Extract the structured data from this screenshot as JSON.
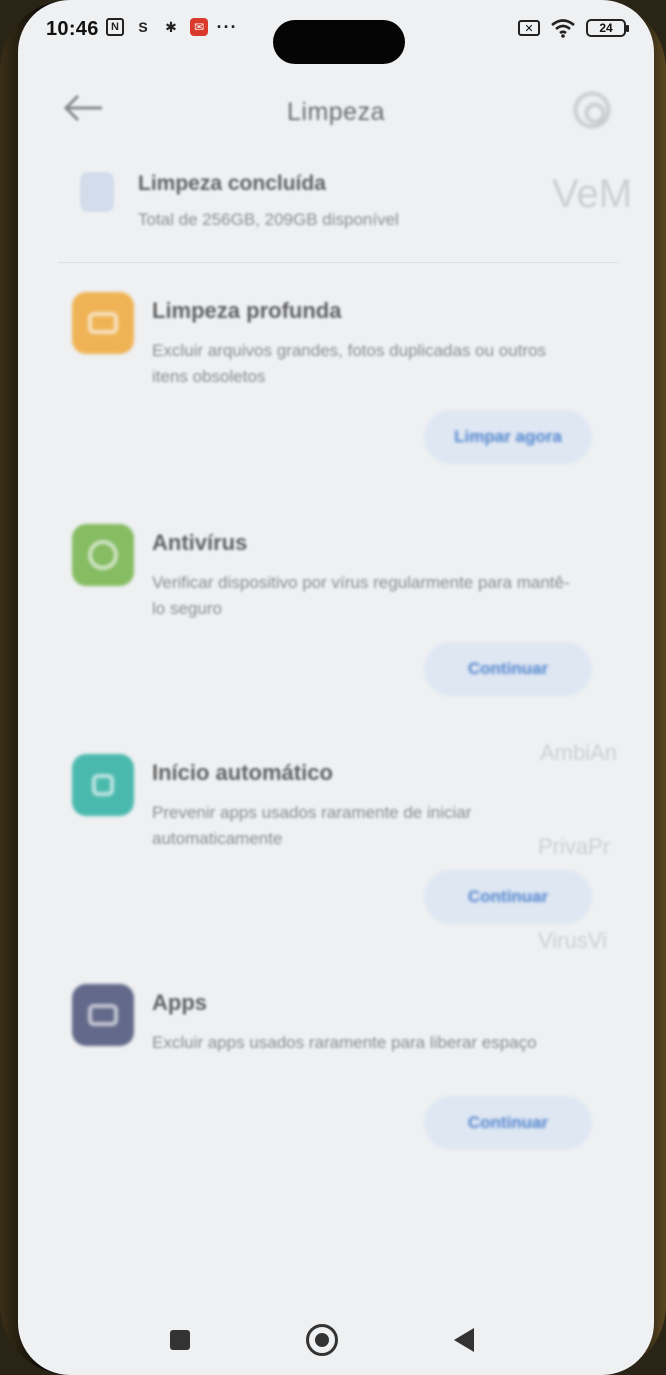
{
  "status_bar": {
    "time": "10:46",
    "icons_left": [
      "nfc-icon",
      "sync-icon",
      "gear-icon",
      "mail-icon",
      "more-icon"
    ],
    "icons_right": [
      "sim-off-icon",
      "wifi-icon",
      "battery-icon"
    ],
    "battery_level": "24",
    "colors": {
      "mail_icon": "#d93a2b"
    }
  },
  "header": {
    "title": "Limpeza",
    "back_icon": "arrow-left-icon",
    "settings_icon": "settings-icon"
  },
  "summary": {
    "title": "Limpeza concluída",
    "subtitle": "Total de 256GB, 209GB disponível"
  },
  "ghost_text": {
    "top_right": "VeM",
    "r1": "AmbiAn",
    "r2": "PrivaPr",
    "r3": "VirusVi"
  },
  "cards": [
    {
      "title": "Limpeza profunda",
      "description": "Excluir arquivos grandes, fotos duplicadas ou outros itens obsoletos",
      "button": "Limpar agora",
      "icon": "broom-icon",
      "color": "#f0a93a"
    },
    {
      "title": "Antivírus",
      "description": "Verificar dispositivo por vírus regularmente para mantê-lo seguro",
      "button": "Continuar",
      "icon": "shield-icon",
      "color": "#74b34a"
    },
    {
      "title": "Início automático",
      "description": "Prevenir apps usados raramente de iniciar automaticamente",
      "button": "Continuar",
      "icon": "autostart-icon",
      "color": "#2eb0a2"
    },
    {
      "title": "Apps",
      "description": "Excluir apps usados raramente para liberar espaço",
      "button": "Continuar",
      "icon": "apps-icon",
      "color": "#4a5278"
    }
  ],
  "nav_bar": {
    "icons": [
      "recents-icon",
      "home-icon",
      "back-icon"
    ]
  }
}
